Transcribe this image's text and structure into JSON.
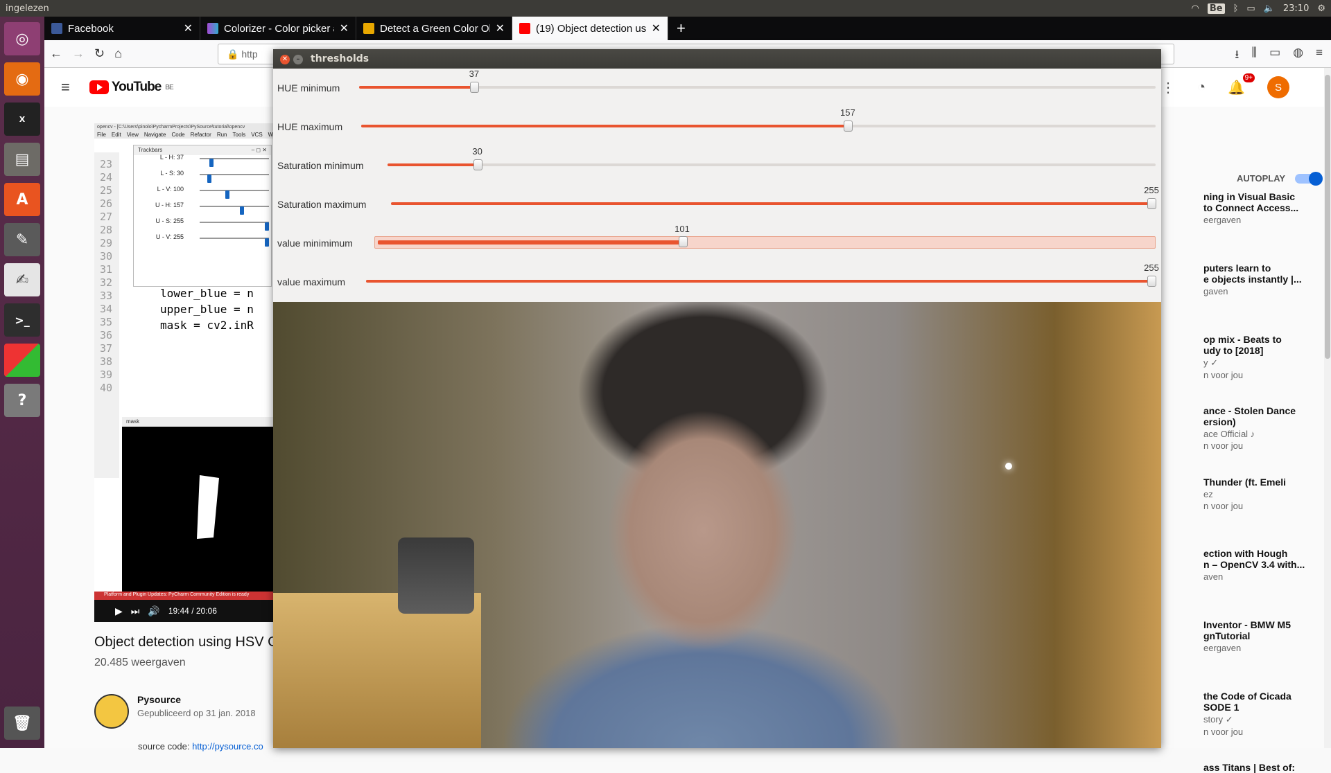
{
  "top_panel": {
    "app_name": "ingelezen",
    "keyboard": "Be",
    "time": "23:10"
  },
  "browser": {
    "tabs": [
      {
        "label": "Facebook",
        "color": "#3b5998"
      },
      {
        "label": "Colorizer - Color picker a",
        "color": "#a34bd3"
      },
      {
        "label": "Detect a Green Color Ob",
        "color": "#e9a800"
      },
      {
        "label": "(19) Object detection us",
        "color": "#ff0000"
      }
    ],
    "url_text": "http"
  },
  "youtube": {
    "logo_text": "YouTube",
    "logo_region": "BE",
    "notification_count": "9+",
    "avatar_letter": "S",
    "video": {
      "title": "Object detection using HSV Color",
      "views": "20.485 weergaven",
      "channel": "Pysource",
      "published": "Gepubliceerd op 31 jan. 2018",
      "source_label": "source code:",
      "source_link": "http://pysource.co",
      "time": "19:44 / 20:06",
      "ide_title": "opencv - [C:\\Users\\pinolo\\PycharmProjects\\PySource\\tutorial\\opencv",
      "ide_menu": [
        "File",
        "Edit",
        "View",
        "Navigate",
        "Code",
        "Refactor",
        "Run",
        "Tools",
        "VCS",
        "W"
      ],
      "trackbars_title": "Trackbars",
      "trackbars": [
        {
          "label": "L - H: 37",
          "value": 37
        },
        {
          "label": "L - S: 30",
          "value": 30
        },
        {
          "label": "L - V: 100",
          "value": 100
        },
        {
          "label": "U - H: 157",
          "value": 157
        },
        {
          "label": "U - S: 255",
          "value": 255
        },
        {
          "label": "U - V: 255",
          "value": 255
        }
      ],
      "line_numbers": [
        "23",
        "24",
        "25",
        "26",
        "27",
        "28",
        "29",
        "30",
        "31",
        "32",
        "33",
        "34",
        "35",
        "36",
        "37",
        "38",
        "39",
        "40"
      ],
      "code_lines": [
        "lower_blue = n",
        "upper_blue = n",
        "mask = cv2.inR"
      ],
      "mask_title": "mask",
      "status_text": "Platform and Plugin Updates: PyCharm Community Edition is ready"
    },
    "autoplay_label": "AUTOPLAY",
    "related": [
      {
        "title": "ning in Visual Basic\nto Connect Access...",
        "meta": "eergaven"
      },
      {
        "title": "puters learn to\ne objects instantly |...",
        "meta": "gaven"
      },
      {
        "title": "op mix - Beats to\nudy to [2018]",
        "meta": "y ✓",
        "meta2": "n voor jou"
      },
      {
        "title": "ance - Stolen Dance\nersion)",
        "meta": "ace Official ♪",
        "meta2": "n voor jou"
      },
      {
        "title": "Thunder (ft. Emeli",
        "meta": "ez",
        "meta2": "n voor jou"
      },
      {
        "title": "ection with Hough\nn – OpenCV 3.4 with...",
        "meta": "aven"
      },
      {
        "title": "Inventor - BMW M5\ngnTutorial",
        "meta": "eergaven"
      },
      {
        "title": "the Code of Cicada\nSODE 1",
        "meta": "story ✓",
        "meta2": "n voor jou"
      },
      {
        "title": "ass Titans | Best of:",
        "meta": ""
      }
    ]
  },
  "thresholds_window": {
    "title": "thresholds",
    "max": 255,
    "sliders": [
      {
        "label": "HUE minimum",
        "value": 37
      },
      {
        "label": "HUE maximum",
        "value": 157
      },
      {
        "label": "Saturation minimum",
        "value": 30
      },
      {
        "label": "Saturation maximum",
        "value": 255
      },
      {
        "label": "value minimimum",
        "value": 101
      },
      {
        "label": "value maximum",
        "value": 255
      }
    ]
  }
}
